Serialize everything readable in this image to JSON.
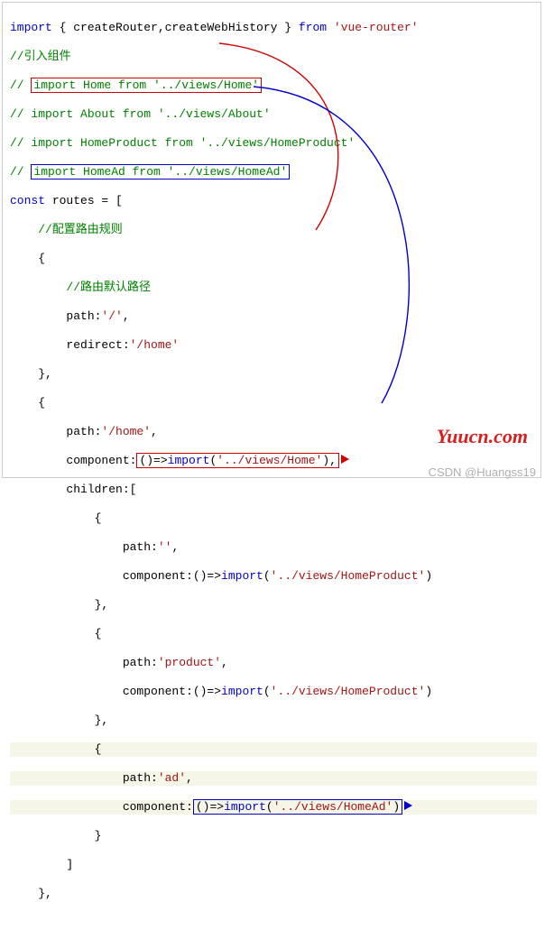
{
  "lines": {
    "l1a": "import",
    "l1b": " { createRouter,createWebHistory } ",
    "l1c": "from",
    "l1d": " ",
    "l1e": "'vue-router'",
    "l2": "//引入组件",
    "l3a": "// ",
    "l3b": "import Home from '../views/Home'",
    "l4": "// import About from '../views/About'",
    "l5": "// import HomeProduct from '../views/HomeProduct'",
    "l6a": "// ",
    "l6b": "import HomeAd from '../views/HomeAd'",
    "l7a": "const",
    "l7b": " routes = [",
    "l8": "    //配置路由规则",
    "l9": "    {",
    "l10": "        //路由默认路径",
    "l11a": "        path:",
    "l11b": "'/'",
    "l11c": ",",
    "l12a": "        redirect:",
    "l12b": "'/home'",
    "l13": "    },",
    "l14": "    {",
    "l15a": "        path:",
    "l15b": "'/home'",
    "l15c": ",",
    "l16a": "        component:",
    "l16b": "()=>",
    "l16c": "import",
    "l16d": "(",
    "l16e": "'../views/Home'",
    "l16f": "),",
    "l17": "        children:[",
    "l18": "            {",
    "l19a": "                path:",
    "l19b": "''",
    "l19c": ",",
    "l20a": "                component:()=>",
    "l20b": "import",
    "l20c": "(",
    "l20d": "'../views/HomeProduct'",
    "l20e": ")",
    "l21": "            },",
    "l22": "            {",
    "l23a": "                path:",
    "l23b": "'product'",
    "l23c": ",",
    "l24a": "                component:()=>",
    "l24b": "import",
    "l24c": "(",
    "l24d": "'../views/HomeProduct'",
    "l24e": ")",
    "l25": "            },",
    "l26": "            {",
    "l27a": "                path:",
    "l27b": "'ad'",
    "l27c": ",",
    "l28a": "                component:",
    "l28b": "()=>",
    "l28c": "import",
    "l28d": "(",
    "l28e": "'../views/HomeAd'",
    "l28f": ")",
    "l29": "            }",
    "l30": "        ]",
    "l31": "    },"
  },
  "watermark": "Yuucn.com",
  "csdn": "CSDN @Huangss19",
  "arrows": {
    "red": {
      "from": "import Home",
      "to": "()=>import('../views/Home')"
    },
    "blue": {
      "from": "import HomeAd",
      "to": "()=>import('../views/HomeAd')"
    }
  }
}
